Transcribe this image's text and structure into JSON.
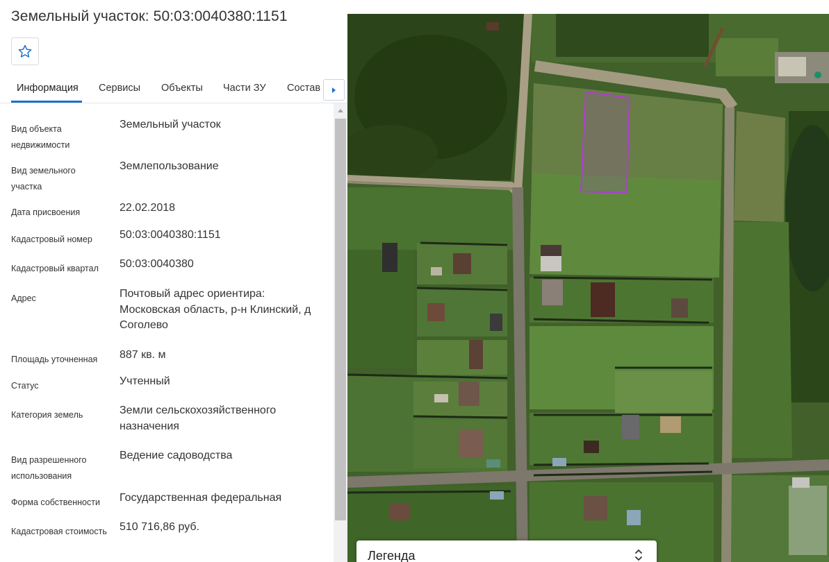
{
  "header": {
    "title": "Земельный участок: 50:03:0040380:1151"
  },
  "favorite": {
    "icon": "star-outline-icon"
  },
  "tabs": [
    {
      "label": "Информация",
      "active": true
    },
    {
      "label": "Сервисы",
      "active": false
    },
    {
      "label": "Объекты",
      "active": false
    },
    {
      "label": "Части ЗУ",
      "active": false
    },
    {
      "label": "Состав",
      "active": false
    }
  ],
  "tabs_scroll": {
    "icon": "chevron-right-icon"
  },
  "info": [
    {
      "label": "Вид объекта недвижимости",
      "value": "Земельный участок"
    },
    {
      "label": "Вид земельного участка",
      "value": "Землепользование"
    },
    {
      "label": "Дата присвоения",
      "value": "22.02.2018"
    },
    {
      "label": "Кадастровый номер",
      "value": "50:03:0040380:1151"
    },
    {
      "label": "Кадастровый квартал",
      "value": "50:03:0040380"
    },
    {
      "label": "Адрес",
      "value": "Почтовый адрес ориентира: Московская область, р-н Клинский, д Соголево"
    },
    {
      "label": "Площадь уточненная",
      "value": "887 кв. м"
    },
    {
      "label": "Статус",
      "value": "Учтенный"
    },
    {
      "label": "Категория земель",
      "value": "Земли сельскохозяйственного назначения"
    },
    {
      "label": "Вид разрешенного использования",
      "value": "Ведение садоводства"
    },
    {
      "label": "Форма собственности",
      "value": "Государственная федеральная"
    },
    {
      "label": "Кадастровая стоимость",
      "value": "510 716,86 руб."
    }
  ],
  "map": {
    "layer": "satellite",
    "highlight_color": "#b23bd6"
  },
  "legend": {
    "label": "Легенда",
    "icon": "expand-collapse-icon"
  },
  "colors": {
    "accent": "#1d6fd1",
    "text": "#333333"
  }
}
